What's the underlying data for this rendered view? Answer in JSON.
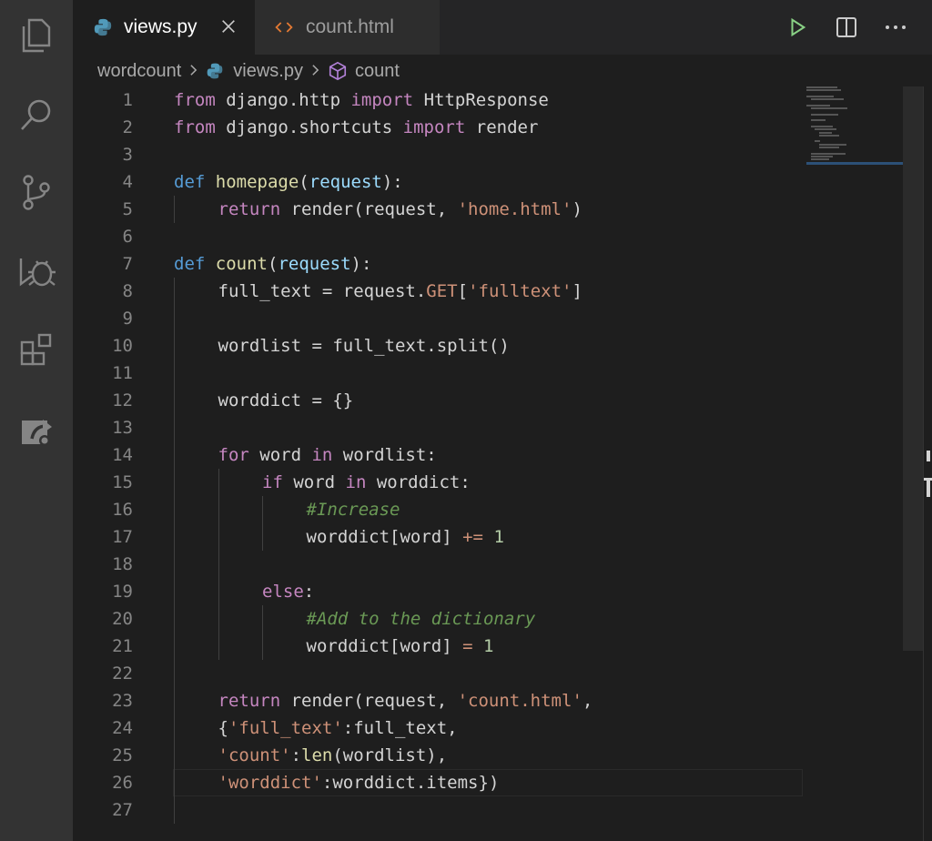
{
  "activity_bar": {
    "items": [
      {
        "name": "explorer-icon"
      },
      {
        "name": "search-icon"
      },
      {
        "name": "source-control-icon"
      },
      {
        "name": "debug-icon"
      },
      {
        "name": "extensions-icon"
      },
      {
        "name": "remote-explorer-icon"
      }
    ]
  },
  "tabs": [
    {
      "label": "views.py",
      "icon": "python-icon",
      "active": true
    },
    {
      "label": "count.html",
      "icon": "html-icon",
      "active": false
    }
  ],
  "editor_actions": [
    {
      "name": "run-icon"
    },
    {
      "name": "split-editor-icon"
    },
    {
      "name": "more-actions-icon"
    }
  ],
  "breadcrumb": {
    "folder": "wordcount",
    "file": "views.py",
    "symbol": "count"
  },
  "code": {
    "line_numbers": [
      "1",
      "2",
      "3",
      "4",
      "5",
      "6",
      "7",
      "8",
      "9",
      "10",
      "11",
      "12",
      "13",
      "14",
      "15",
      "16",
      "17",
      "18",
      "19",
      "20",
      "21",
      "22",
      "23",
      "24",
      "25",
      "26",
      "27"
    ],
    "lines": {
      "l1": [
        "from",
        " django.http ",
        "import",
        " HttpResponse"
      ],
      "l2": [
        "from",
        " django.shortcuts ",
        "import",
        " render"
      ],
      "l4": [
        "def",
        " ",
        "homepage",
        "(",
        "request",
        "):"
      ],
      "l5": [
        "return",
        " render(request, ",
        "'home.html'",
        ")"
      ],
      "l7": [
        "def",
        " ",
        "count",
        "(",
        "request",
        "):"
      ],
      "l8": [
        "full_text = request.",
        "GET",
        "[",
        "'fulltext'",
        "]"
      ],
      "l10": [
        "wordlist = full_text.split()"
      ],
      "l12": [
        "worddict = {}"
      ],
      "l14": [
        "for",
        " word ",
        "in",
        " wordlist:"
      ],
      "l15": [
        "if",
        " word ",
        "in",
        " worddict:"
      ],
      "l16": [
        "#Increase"
      ],
      "l17": [
        "worddict[word] ",
        "+=",
        " ",
        "1"
      ],
      "l19": [
        "else",
        ":"
      ],
      "l20": [
        "#Add to the dictionary"
      ],
      "l21": [
        "worddict[word] ",
        "=",
        " ",
        "1"
      ],
      "l23": [
        "return",
        " render(request, ",
        "'count.html'",
        ","
      ],
      "l24": [
        "{",
        "'full_text'",
        ":full_text,"
      ],
      "l25": [
        "'count'",
        ":",
        "len",
        "(wordlist),"
      ],
      "l26": [
        "'worddict'",
        ":worddict.items",
        "}",
        ")"
      ]
    }
  },
  "colors": {
    "keyword": "#c586c0",
    "storage": "#569cd6",
    "function": "#dcdcaa",
    "parameter": "#9cdcfe",
    "string": "#ce9178",
    "number": "#b5cea8",
    "comment": "#6a9955"
  }
}
